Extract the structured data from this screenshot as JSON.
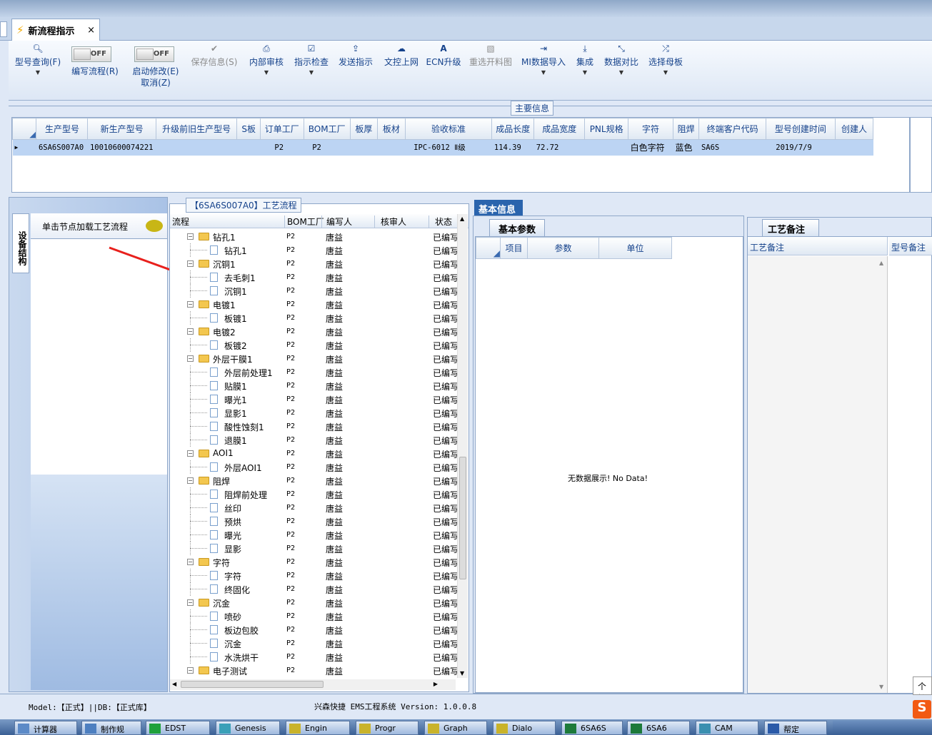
{
  "window": {
    "tab_title": "新流程指示",
    "tab_close": "×"
  },
  "toolbar": {
    "items": [
      {
        "icon": "search",
        "label": "型号查询(F)",
        "dropdown": true
      },
      {
        "icon": "toggle",
        "label": "编写流程(R)",
        "toggle": "OFF"
      },
      {
        "icon": "toggle",
        "label": "启动修改(E)",
        "label2": "取消(Z)",
        "toggle": "OFF"
      },
      {
        "icon": "check",
        "label": "保存信息(S)",
        "disabled": true
      },
      {
        "icon": "print",
        "label": "内部审核",
        "dropdown": true
      },
      {
        "icon": "checklist",
        "label": "指示检查",
        "dropdown": true
      },
      {
        "icon": "upload",
        "label": "发送指示"
      },
      {
        "icon": "cloud-upload",
        "label": "文控上网"
      },
      {
        "icon": "ecn",
        "label": "ECN升级"
      },
      {
        "icon": "image",
        "label": "重选开料图",
        "disabled": true
      },
      {
        "icon": "import",
        "label": "MI数据导入",
        "dropdown": true
      },
      {
        "icon": "download",
        "label": "集成",
        "dropdown": true
      },
      {
        "icon": "compare",
        "label": "数据对比",
        "dropdown": true
      },
      {
        "icon": "shuffle",
        "label": "选择母板",
        "dropdown": true
      }
    ]
  },
  "main_info": {
    "title": "主要信息",
    "columns": [
      "生产型号",
      "新生产型号",
      "升级前旧生产型号",
      "S板",
      "订单工厂",
      "BOM工厂",
      "板厚",
      "板材",
      "验收标准",
      "成品长度",
      "成品宽度",
      "PNL规格",
      "字符",
      "阻焊",
      "终端客户代码",
      "型号创建时间",
      "创建人"
    ],
    "row": [
      "6SA6S007A0",
      "10010600074221",
      "",
      "",
      "P2",
      "P2",
      "",
      "",
      "IPC-6012 Ⅱ级",
      "114.39",
      "72.72",
      "",
      "白色字符",
      "蓝色",
      "SA6S",
      "2019/7/9",
      ""
    ]
  },
  "side_panel": {
    "vertical_tab": "设备结构",
    "hint": "单击节点加载工艺流程"
  },
  "process": {
    "title": "【6SA6S007A0】工艺流程",
    "columns": [
      "流程",
      "BOM工厂",
      "编写人",
      "核审人",
      "状态"
    ],
    "rows": [
      {
        "level": 0,
        "name": "钻孔1",
        "bom": "P2",
        "writer": "唐益",
        "status": "已编写"
      },
      {
        "level": 1,
        "name": "钻孔1",
        "bom": "P2",
        "writer": "唐益",
        "status": "已编写"
      },
      {
        "level": 0,
        "name": "沉铜1",
        "bom": "P2",
        "writer": "唐益",
        "status": "已编写"
      },
      {
        "level": 1,
        "name": "去毛刺1",
        "bom": "P2",
        "writer": "唐益",
        "status": "已编写"
      },
      {
        "level": 1,
        "name": "沉铜1",
        "bom": "P2",
        "writer": "唐益",
        "status": "已编写"
      },
      {
        "level": 0,
        "name": "电镀1",
        "bom": "P2",
        "writer": "唐益",
        "status": "已编写"
      },
      {
        "level": 1,
        "name": "板镀1",
        "bom": "P2",
        "writer": "唐益",
        "status": "已编写"
      },
      {
        "level": 0,
        "name": "电镀2",
        "bom": "P2",
        "writer": "唐益",
        "status": "已编写"
      },
      {
        "level": 1,
        "name": "板镀2",
        "bom": "P2",
        "writer": "唐益",
        "status": "已编写"
      },
      {
        "level": 0,
        "name": "外层干膜1",
        "bom": "P2",
        "writer": "唐益",
        "status": "已编写"
      },
      {
        "level": 1,
        "name": "外层前处理1",
        "bom": "P2",
        "writer": "唐益",
        "status": "已编写"
      },
      {
        "level": 1,
        "name": "贴膜1",
        "bom": "P2",
        "writer": "唐益",
        "status": "已编写"
      },
      {
        "level": 1,
        "name": "曝光1",
        "bom": "P2",
        "writer": "唐益",
        "status": "已编写"
      },
      {
        "level": 1,
        "name": "显影1",
        "bom": "P2",
        "writer": "唐益",
        "status": "已编写"
      },
      {
        "level": 1,
        "name": "酸性蚀刻1",
        "bom": "P2",
        "writer": "唐益",
        "status": "已编写"
      },
      {
        "level": 1,
        "name": "退膜1",
        "bom": "P2",
        "writer": "唐益",
        "status": "已编写"
      },
      {
        "level": 0,
        "name": "AOI1",
        "bom": "P2",
        "writer": "唐益",
        "status": "已编写"
      },
      {
        "level": 1,
        "name": "外层AOI1",
        "bom": "P2",
        "writer": "唐益",
        "status": "已编写"
      },
      {
        "level": 0,
        "name": "阻焊",
        "bom": "P2",
        "writer": "唐益",
        "status": "已编写"
      },
      {
        "level": 1,
        "name": "阻焊前处理",
        "bom": "P2",
        "writer": "唐益",
        "status": "已编写"
      },
      {
        "level": 1,
        "name": "丝印",
        "bom": "P2",
        "writer": "唐益",
        "status": "已编写"
      },
      {
        "level": 1,
        "name": "预烘",
        "bom": "P2",
        "writer": "唐益",
        "status": "已编写"
      },
      {
        "level": 1,
        "name": "曝光",
        "bom": "P2",
        "writer": "唐益",
        "status": "已编写"
      },
      {
        "level": 1,
        "name": "显影",
        "bom": "P2",
        "writer": "唐益",
        "status": "已编写"
      },
      {
        "level": 0,
        "name": "字符",
        "bom": "P2",
        "writer": "唐益",
        "status": "已编写"
      },
      {
        "level": 1,
        "name": "字符",
        "bom": "P2",
        "writer": "唐益",
        "status": "已编写"
      },
      {
        "level": 1,
        "name": "终固化",
        "bom": "P2",
        "writer": "唐益",
        "status": "已编写"
      },
      {
        "level": 0,
        "name": "沉金",
        "bom": "P2",
        "writer": "唐益",
        "status": "已编写"
      },
      {
        "level": 1,
        "name": "喷砂",
        "bom": "P2",
        "writer": "唐益",
        "status": "已编写"
      },
      {
        "level": 1,
        "name": "板边包胶",
        "bom": "P2",
        "writer": "唐益",
        "status": "已编写"
      },
      {
        "level": 1,
        "name": "沉金",
        "bom": "P2",
        "writer": "唐益",
        "status": "已编写"
      },
      {
        "level": 1,
        "name": "水洗烘干",
        "bom": "P2",
        "writer": "唐益",
        "status": "已编写"
      },
      {
        "level": 0,
        "name": "电子测试",
        "bom": "P2",
        "writer": "唐益",
        "status": "已编写"
      }
    ]
  },
  "basic_info": {
    "tab": "基本信息",
    "sub_tab": "基本参数",
    "columns": [
      "项目",
      "参数",
      "单位"
    ],
    "empty": "无数据展示! No Data!"
  },
  "notes": {
    "tab": "工艺备注",
    "columns": [
      "工艺备注",
      "型号备注"
    ]
  },
  "status_bar": {
    "left": "Model:【正式】||DB:【正式库】",
    "center": "兴森快捷 EMS工程系统 Version: 1.0.0.8"
  },
  "tooltip": "个性",
  "taskbar": [
    "计算器",
    "制作规",
    "EDST",
    "Genesis",
    "Engin",
    "Progr",
    "Graph",
    "Dialo",
    "6SA6S",
    "6SA6",
    "CAM",
    "帮定"
  ]
}
